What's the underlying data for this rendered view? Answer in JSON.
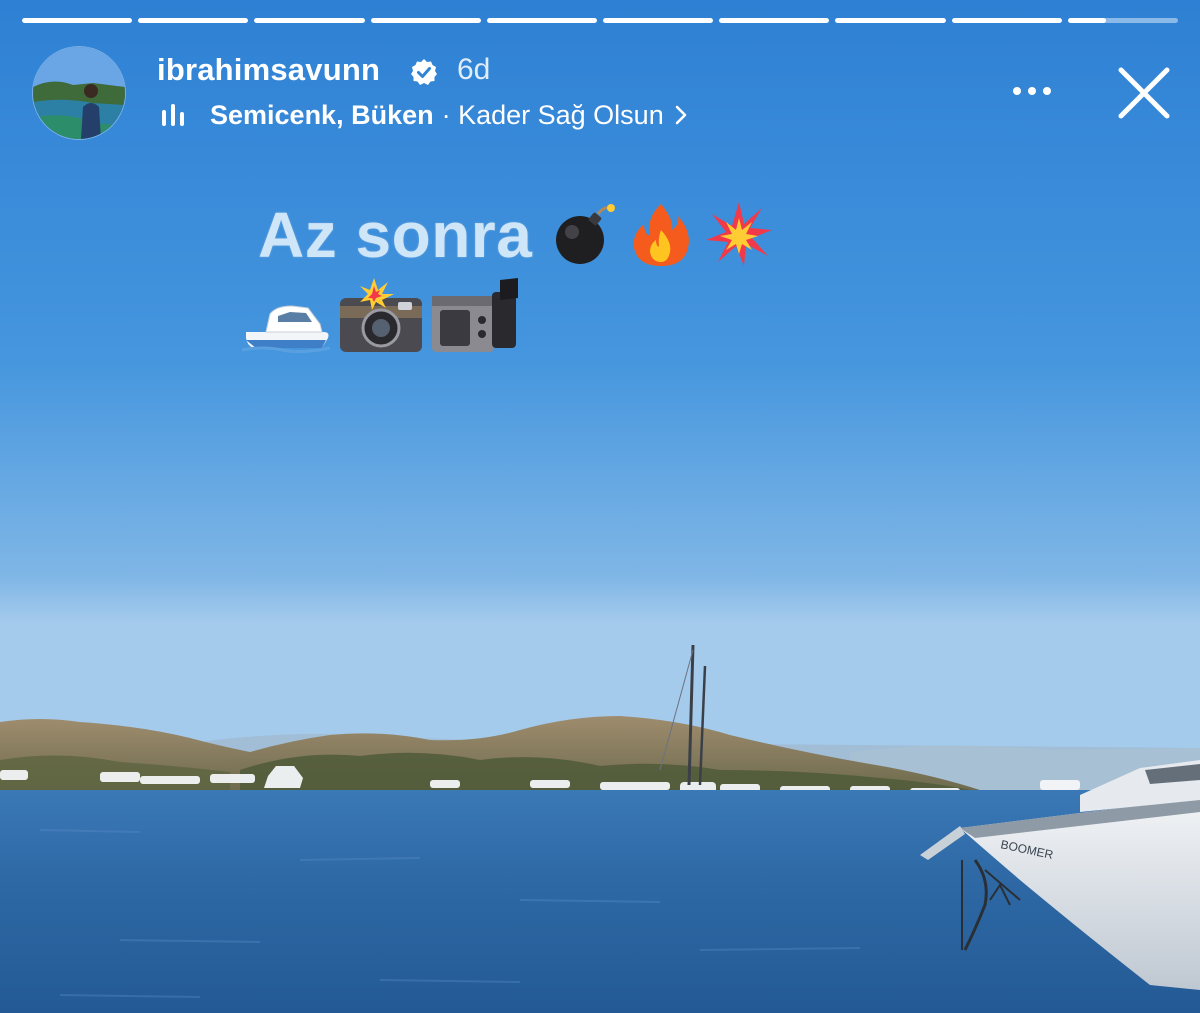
{
  "story": {
    "progress": [
      1,
      1,
      1,
      1,
      1,
      1,
      1,
      1,
      1,
      0.35
    ],
    "header": {
      "username": "ibrahimsavunn",
      "verified": true,
      "time": "6d",
      "music": {
        "artist": "Semicenk, Büken",
        "song": "· Kader Sağ Olsun"
      }
    },
    "sticker": {
      "text": "Az sonra",
      "emoji_line1": [
        "bomb-icon",
        "fire-icon",
        "collision-icon"
      ],
      "emoji_line2": [
        "motor-boat-icon",
        "camera-with-flash-icon",
        "video-camera-icon"
      ]
    },
    "colors": {
      "sky_top": "#2e82d5",
      "sky_bottom": "#93c3ea",
      "sea": "#2c68a4",
      "text": "#ffffff"
    }
  }
}
